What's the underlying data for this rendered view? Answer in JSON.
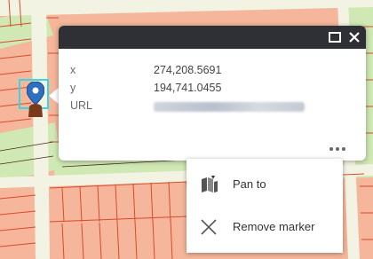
{
  "popup": {
    "fields": [
      {
        "key": "x",
        "value": "274,208.5691"
      },
      {
        "key": "y",
        "value": "194,741.0455"
      },
      {
        "key": "URL",
        "value": ""
      }
    ]
  },
  "context_menu": {
    "items": [
      {
        "label": "Pan to",
        "icon": "pan-to-icon"
      },
      {
        "label": "Remove marker",
        "icon": "close-x-icon"
      }
    ]
  },
  "colors": {
    "parcel_fill": "#f5b69b",
    "parcel_line": "#d94b2b",
    "road": "#f3f3e4",
    "green": "#cfe8b4",
    "header": "#2f3036",
    "marker": "#2f6fbf",
    "selection": "#35d6e6"
  }
}
